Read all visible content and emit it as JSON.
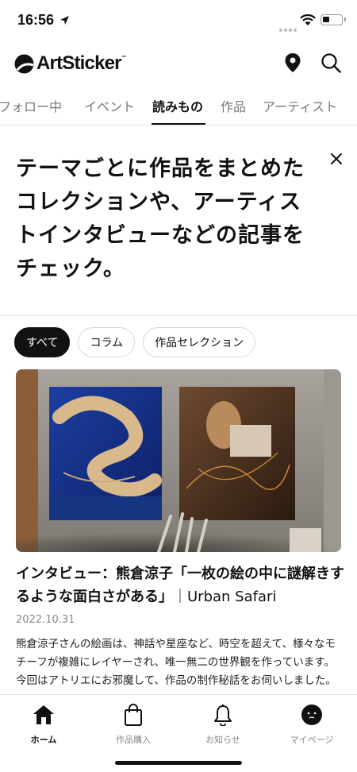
{
  "status_bar": {
    "time": "16:56"
  },
  "header": {
    "logo_text": "ArtSticker",
    "logo_tm": "™"
  },
  "tabs": [
    {
      "label": "フォロー中"
    },
    {
      "label": "イベント"
    },
    {
      "label": "読みもの"
    },
    {
      "label": "作品"
    },
    {
      "label": "アーティスト"
    }
  ],
  "active_tab": "読みもの",
  "intro": {
    "text": "テーマごとに作品をまとめたコレクションや、アーティストインタビューなどの記事をチェック。"
  },
  "filters": [
    {
      "label": "すべて",
      "selected": true
    },
    {
      "label": "コラム",
      "selected": false
    },
    {
      "label": "作品セレクション",
      "selected": false
    }
  ],
  "article": {
    "title": "インタビュー：熊倉涼子「一枚の絵の中に謎解きするような面白さがある」",
    "source": "｜Urban Safari",
    "date": "2022.10.31",
    "body": "熊倉涼子さんの絵画は、神話や星座など、時空を超えて、様々なモチーフが複雑にレイヤーされ、唯一無二の世界観を作っています。今回はアトリエにお邪魔して、作品の制作秘話をお伺いしました。"
  },
  "bottom_nav": [
    {
      "label": "ホーム",
      "icon": "home-icon",
      "active": true
    },
    {
      "label": "作品購入",
      "icon": "shopping-bag-icon",
      "active": false
    },
    {
      "label": "お知らせ",
      "icon": "bell-icon",
      "active": false
    },
    {
      "label": "マイページ",
      "icon": "avatar-icon",
      "active": false
    }
  ],
  "colors": {
    "accent": "#111111",
    "muted": "#888888",
    "divider": "#e2e2e2"
  }
}
